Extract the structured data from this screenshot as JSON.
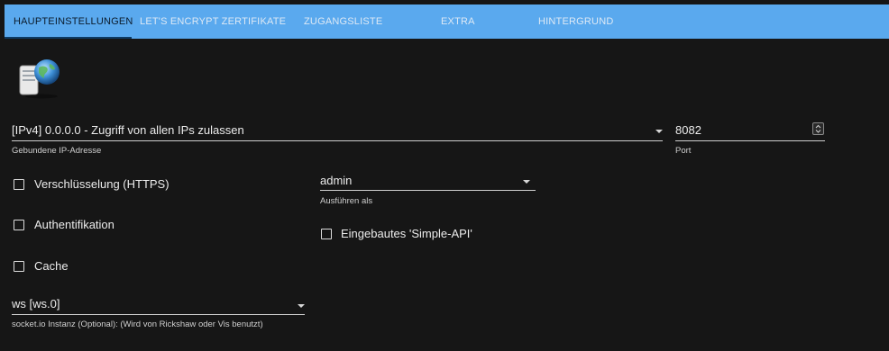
{
  "tabs": [
    {
      "label": "HAUPTEINSTELLUNGEN",
      "active": true
    },
    {
      "label": "LET'S ENCRYPT ZERTIFIKATE",
      "active": false
    },
    {
      "label": "ZUGANGSLISTE",
      "active": false
    },
    {
      "label": "EXTRA",
      "active": false
    },
    {
      "label": "HINTERGRUND",
      "active": false
    }
  ],
  "logo": "server-globe-icon",
  "bind": {
    "value": "[IPv4] 0.0.0.0 - Zugriff von allen IPs zulassen",
    "helper": "Gebundene IP-Adresse"
  },
  "port": {
    "value": "8082",
    "helper": "Port"
  },
  "run_as": {
    "value": "admin",
    "helper": "Ausführen als"
  },
  "checkboxes": {
    "https": {
      "label": "Verschlüsselung (HTTPS)",
      "checked": false
    },
    "auth": {
      "label": "Authentifikation",
      "checked": false
    },
    "cache": {
      "label": "Cache",
      "checked": false
    },
    "simple_api": {
      "label": "Eingebautes 'Simple-API'",
      "checked": false
    }
  },
  "socketio": {
    "value": "ws [ws.0]",
    "helper": "socket.io Instanz (Optional): (Wird von Rickshaw oder Vis benutzt)"
  },
  "colors": {
    "tabbar": "#5aa9ee",
    "background": "#161616",
    "active_tab_indicator": "#0d3a63"
  }
}
